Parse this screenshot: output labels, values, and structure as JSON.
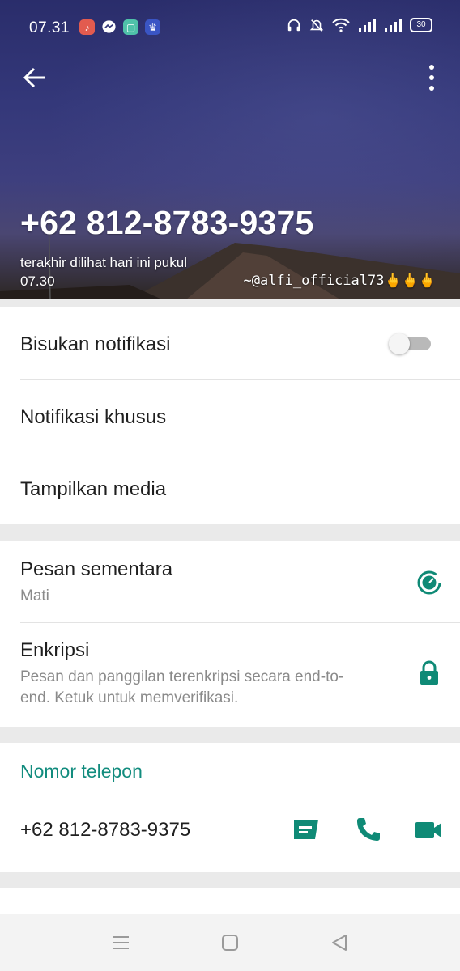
{
  "status_bar": {
    "time": "07.31",
    "battery": "30",
    "left_icons": [
      "music-app-icon",
      "messenger-icon",
      "chat-app-icon",
      "game-app-icon"
    ],
    "right_icons": [
      "headphones-icon",
      "mute-bell-icon",
      "wifi-icon",
      "signal-icon",
      "signal-icon"
    ]
  },
  "header": {
    "contact_name": "+62 812-8783-9375",
    "last_seen": "terakhir dilihat hari ini pukul 07.30",
    "about": "~@alfi_official73🖕🖕🖕"
  },
  "settings": {
    "mute_notifications": {
      "label": "Bisukan notifikasi",
      "enabled": false
    },
    "custom_notifications": {
      "label": "Notifikasi khusus"
    },
    "show_media": {
      "label": "Tampilkan media"
    }
  },
  "privacy": {
    "disappearing": {
      "label": "Pesan sementara",
      "value": "Mati"
    },
    "encryption": {
      "label": "Enkripsi",
      "description": "Pesan dan panggilan terenkripsi secara end-to-end. Ketuk untuk memverifikasi."
    }
  },
  "phone_section": {
    "title": "Nomor telepon",
    "number": "+62 812-8783-9375"
  },
  "colors": {
    "accent": "#128c7e",
    "icon": "#0f8a76",
    "text_primary": "#1f1f1f",
    "text_secondary": "#8a8a8a"
  }
}
